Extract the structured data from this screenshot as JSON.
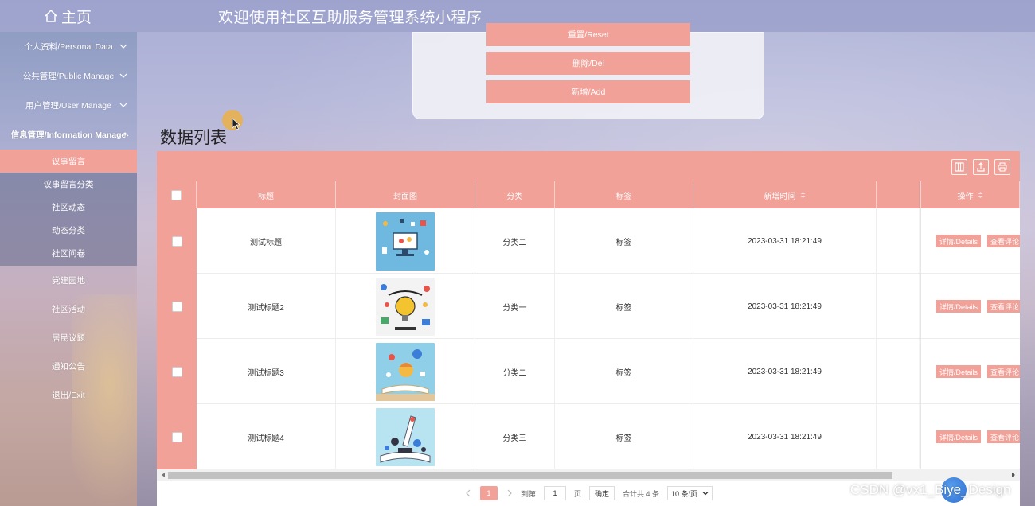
{
  "header": {
    "home_label": "主页",
    "app_title": "欢迎使用社区互助服务管理系统小程序"
  },
  "sidebar": {
    "items": [
      {
        "label": "个人资料/Personal Data"
      },
      {
        "label": "公共管理/Public Manage"
      },
      {
        "label": "用户管理/User Manage"
      },
      {
        "label": "信息管理/Information Manage"
      }
    ],
    "submenu": [
      {
        "label": "议事留言",
        "active": true
      },
      {
        "label": "议事留言分类"
      },
      {
        "label": "社区动态"
      },
      {
        "label": "动态分类"
      },
      {
        "label": "社区问卷"
      }
    ],
    "bottom_items": [
      {
        "label": "党建园地"
      },
      {
        "label": "社区活动"
      },
      {
        "label": "居民议题"
      },
      {
        "label": "通知公告"
      },
      {
        "label": "退出/Exit"
      }
    ]
  },
  "search_panel": {
    "reset_label": "重置/Reset",
    "delete_label": "删除/Del",
    "add_label": "新增/Add"
  },
  "list": {
    "section_title": "数据列表",
    "columns": [
      "标题",
      "封面图",
      "分类",
      "标签",
      "新增时间",
      "操作"
    ],
    "rows": [
      {
        "title": "测试标题",
        "category": "分类二",
        "tag": "标签",
        "time": "2023-03-31 18:21:49"
      },
      {
        "title": "测试标题2",
        "category": "分类一",
        "tag": "标签",
        "time": "2023-03-31 18:21:49"
      },
      {
        "title": "测试标题3",
        "category": "分类二",
        "tag": "标签",
        "time": "2023-03-31 18:21:49"
      },
      {
        "title": "测试标题4",
        "category": "分类三",
        "tag": "标签",
        "time": "2023-03-31 18:21:49"
      }
    ],
    "details_label": "详情/Details",
    "comments_label": "查看评论"
  },
  "pagination": {
    "current_page": "1",
    "goto_label": "到第",
    "goto_value": "1",
    "page_unit": "页",
    "confirm_label": "确定",
    "total_label": "合计共 4 条",
    "page_size": "10 条/页"
  },
  "watermark": "CSDN @vx1_Biye_Design",
  "colors": {
    "accent": "#f2a199",
    "header_bg": "#9a9fcc"
  }
}
